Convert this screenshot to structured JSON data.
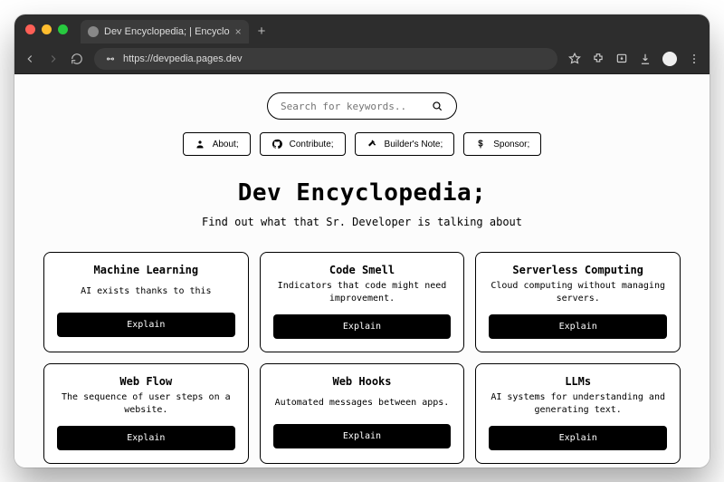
{
  "browser": {
    "tab_title": "Dev Encyclopedia; | Encyclo",
    "url": "https://devpedia.pages.dev",
    "plus_label": "+"
  },
  "search": {
    "placeholder": "Search for keywords.."
  },
  "nav": {
    "items": [
      {
        "id": "about",
        "label": "About;",
        "icon": "person-icon"
      },
      {
        "id": "contrib",
        "label": "Contribute;",
        "icon": "github-icon"
      },
      {
        "id": "builder",
        "label": "Builder's Note;",
        "icon": "hammer-icon"
      },
      {
        "id": "sponsor",
        "label": "Sponsor;",
        "icon": "dollar-icon"
      }
    ]
  },
  "hero": {
    "title": "Dev Encyclopedia;",
    "subtitle": "Find out what that Sr. Developer is talking about"
  },
  "card_button_label": "Explain",
  "cards": [
    {
      "title": "Machine Learning",
      "desc": "AI exists thanks to this"
    },
    {
      "title": "Code Smell",
      "desc": "Indicators that code might need improvement."
    },
    {
      "title": "Serverless Computing",
      "desc": "Cloud computing without managing servers."
    },
    {
      "title": "Web Flow",
      "desc": "The sequence of user steps on a website."
    },
    {
      "title": "Web Hooks",
      "desc": "Automated messages between apps."
    },
    {
      "title": "LLMs",
      "desc": "AI systems for understanding and generating text."
    }
  ]
}
